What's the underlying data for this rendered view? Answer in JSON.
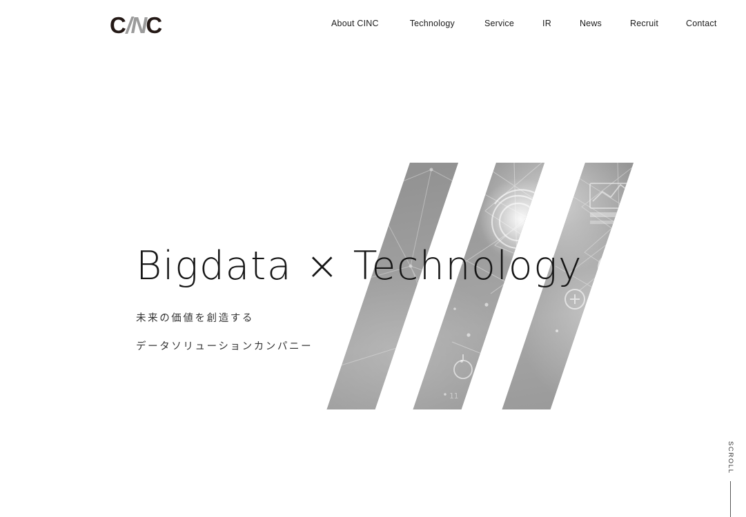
{
  "site": {
    "logo": {
      "full_text": "CINC",
      "part_1": "C",
      "part_2": "/",
      "part_3": "N",
      "part_4": "C",
      "dark_color": "#231815",
      "gray_color": "#9b9b9b"
    }
  },
  "nav": {
    "items": [
      {
        "label": "About CINC"
      },
      {
        "label": "Technology"
      },
      {
        "label": "Service"
      },
      {
        "label": "IR"
      },
      {
        "label": "News"
      },
      {
        "label": "Recruit"
      },
      {
        "label": "Contact"
      }
    ]
  },
  "hero": {
    "title": "Bigdata  ×  Technology",
    "subtitle_line1": "未来の価値を創造する",
    "subtitle_line2": "データソリューションカンパニー",
    "visual": {
      "description": "three slanted grayscale bars with digital network imagery",
      "bar_count": 3,
      "base_color": "#9d9d9d"
    }
  },
  "scroll_indicator": {
    "label": "SCROLL"
  }
}
